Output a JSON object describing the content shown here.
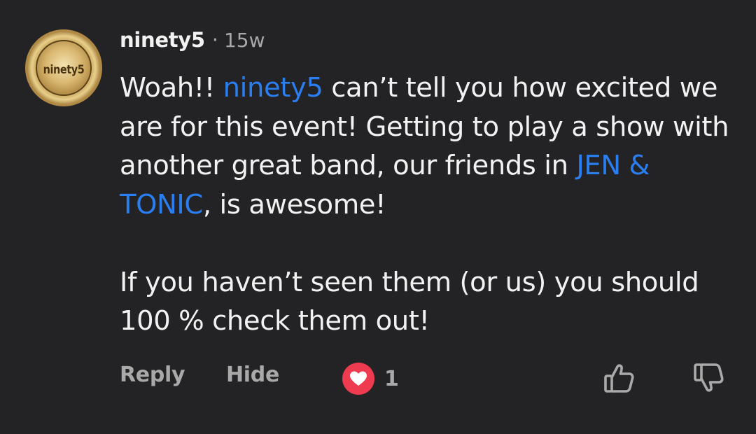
{
  "comment": {
    "avatar": {
      "logo_text": "ninety5",
      "icon": "band-logo-avatar"
    },
    "author": "ninety5",
    "separator": "·",
    "time": "15w",
    "paragraph1": {
      "text_before": "Woah!! ",
      "mention1": "ninety5",
      "text_middle": " can’t tell you how excited we are for this event! Getting to play a show with another great band, our friends in ",
      "mention2": "JEN & TONIC",
      "text_after": ", is awesome!"
    },
    "paragraph2": "If you haven’t seen them (or us) you should 100 % check them out!",
    "actions": {
      "reply_label": "Reply",
      "hide_label": "Hide",
      "like_count": "1",
      "like_icon": "heart-icon",
      "thumb_up_icon": "thumbs-up-icon",
      "thumb_down_icon": "thumbs-down-icon"
    },
    "colors": {
      "background": "#232325",
      "mention": "#2a7ef0",
      "heart_badge": "#ef3b4f",
      "muted": "#a9a9a9"
    }
  }
}
